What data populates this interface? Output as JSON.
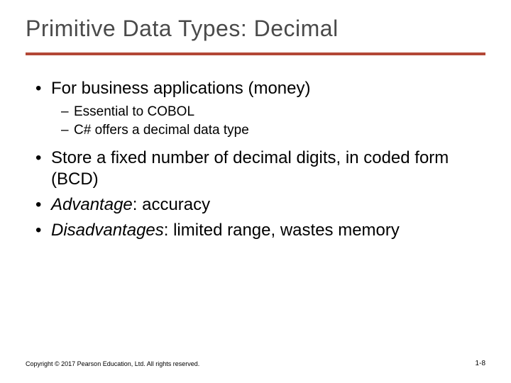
{
  "title": "Primitive Data Types: Decimal",
  "bullets": {
    "b1": "For business applications (money)",
    "b1_sub1": "Essential to COBOL",
    "b1_sub2": "C# offers a decimal data type",
    "b2": "Store a fixed number of decimal digits, in coded form (BCD)",
    "b3_em": "Advantage",
    "b3_rest": ": accuracy",
    "b4_em": "Disadvantages",
    "b4_rest": ": limited range, wastes memory"
  },
  "footer": {
    "copyright": "Copyright © 2017 Pearson Education, Ltd. All rights reserved.",
    "page": "1-8"
  }
}
